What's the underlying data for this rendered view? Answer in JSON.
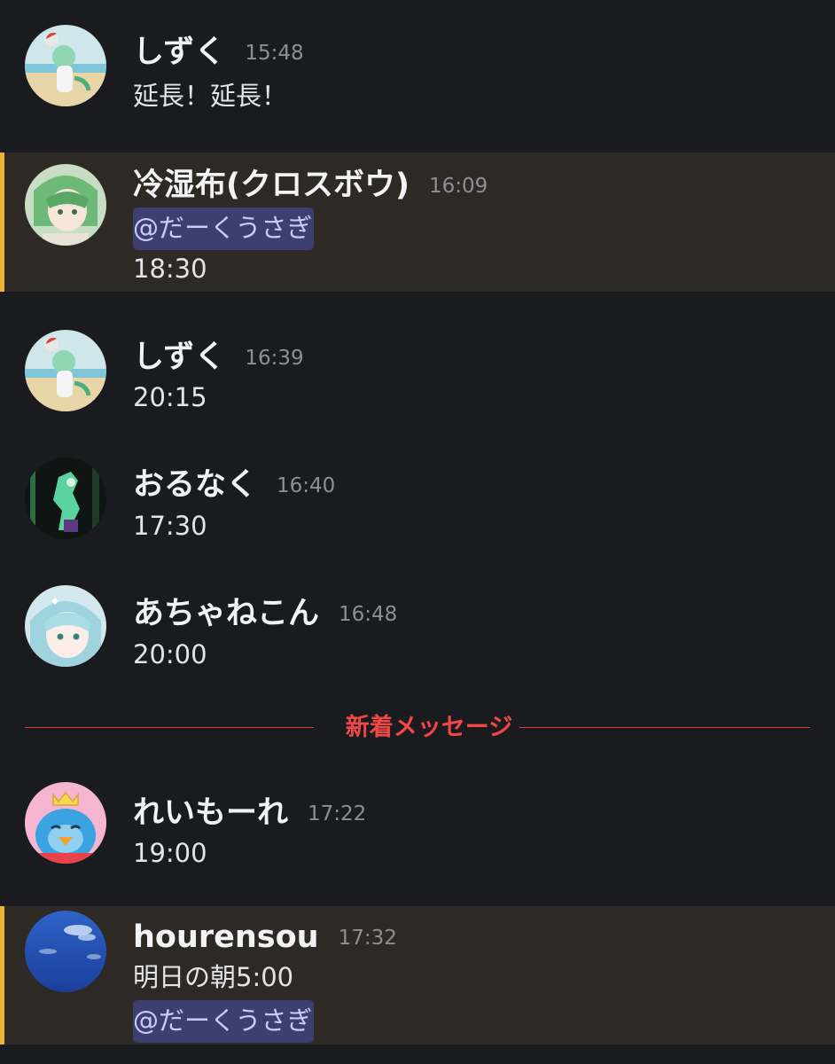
{
  "colors": {
    "background": "#1a1b1f",
    "highlight_background": "#2d2a26",
    "highlight_bar": "#f0b232",
    "mention_background": "#3c3f70",
    "mention_text": "#c9cdfb",
    "new_divider": "#f04747"
  },
  "messages": [
    {
      "username": "しずく",
      "time": "15:48",
      "lines": [
        "延長！延長！"
      ],
      "avatar": "green-hair-girl-beach-avatar"
    },
    {
      "username": "冷湿布(クロスボウ)",
      "time": "16:09",
      "mention": "@だーくうさぎ",
      "lines": [
        "18:30"
      ],
      "avatar": "green-hair-anime-avatar",
      "highlighted": true
    },
    {
      "username": "しずく",
      "time": "16:39",
      "lines": [
        "20:15"
      ],
      "avatar": "green-hair-girl-beach-avatar"
    },
    {
      "username": "おるなく",
      "time": "16:40",
      "lines": [
        "17:30"
      ],
      "avatar": "dark-green-figure-avatar"
    },
    {
      "username": "あちゃねこん",
      "time": "16:48",
      "lines": [
        "20:00"
      ],
      "avatar": "cyan-hair-girl-avatar"
    },
    {
      "username": "れいもーれ",
      "time": "17:22",
      "lines": [
        "19:00"
      ],
      "avatar": "penguin-king-avatar"
    },
    {
      "username": "hourensou",
      "time": "17:32",
      "lines": [
        "明日の朝5:00"
      ],
      "mention": "@だーくうさぎ",
      "avatar": "blue-sky-avatar",
      "highlighted": true
    }
  ],
  "divider": {
    "label": "新着メッセージ"
  }
}
